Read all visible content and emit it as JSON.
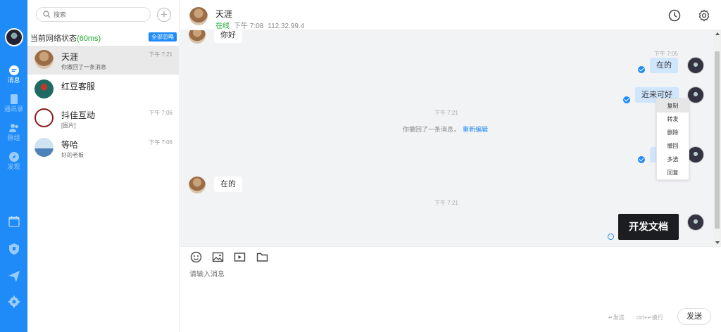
{
  "rail": {
    "items": [
      {
        "label": "消息"
      },
      {
        "label": "通讯录"
      },
      {
        "label": "群组"
      },
      {
        "label": "发现"
      }
    ]
  },
  "list": {
    "search_placeholder": "搜索",
    "net_label": "当前网络状态",
    "net_ms": "(60ms)",
    "read_all": "全部忽略",
    "conversations": [
      {
        "name": "天涯",
        "time": "下午 7:21",
        "preview": "你撤回了一条消息"
      },
      {
        "name": "红豆客服",
        "time": "",
        "preview": ""
      },
      {
        "name": "抖佳互动",
        "time": "下午 7:06",
        "preview": "[图片]"
      },
      {
        "name": "等哈",
        "time": "下午 7:06",
        "preview": "好的老板"
      }
    ]
  },
  "chat": {
    "contact_name": "天涯",
    "status": "在线",
    "last_time": "下午 7:08",
    "ip": "112.32.99.4",
    "messages": {
      "m1": "你好",
      "t1": "下午 7:05",
      "m2": "在的",
      "m3": "近来可好",
      "t2": "下午 7:21",
      "recall_text": "你撤回了一条消息，",
      "reedit": "重新编辑",
      "m4": "在的",
      "t3": "下午 7:21",
      "image_text": "开发文档"
    },
    "context_menu": [
      "复制",
      "转发",
      "删除",
      "撤回",
      "多选",
      "回复"
    ]
  },
  "composer": {
    "placeholder": "请输入消息",
    "hint_send": "发送",
    "hint_newline": "ctrl+",
    "hint_newline2": "换行",
    "send": "发送"
  },
  "colors": {
    "accent": "#1e8bf8",
    "online": "#1aab2b"
  }
}
